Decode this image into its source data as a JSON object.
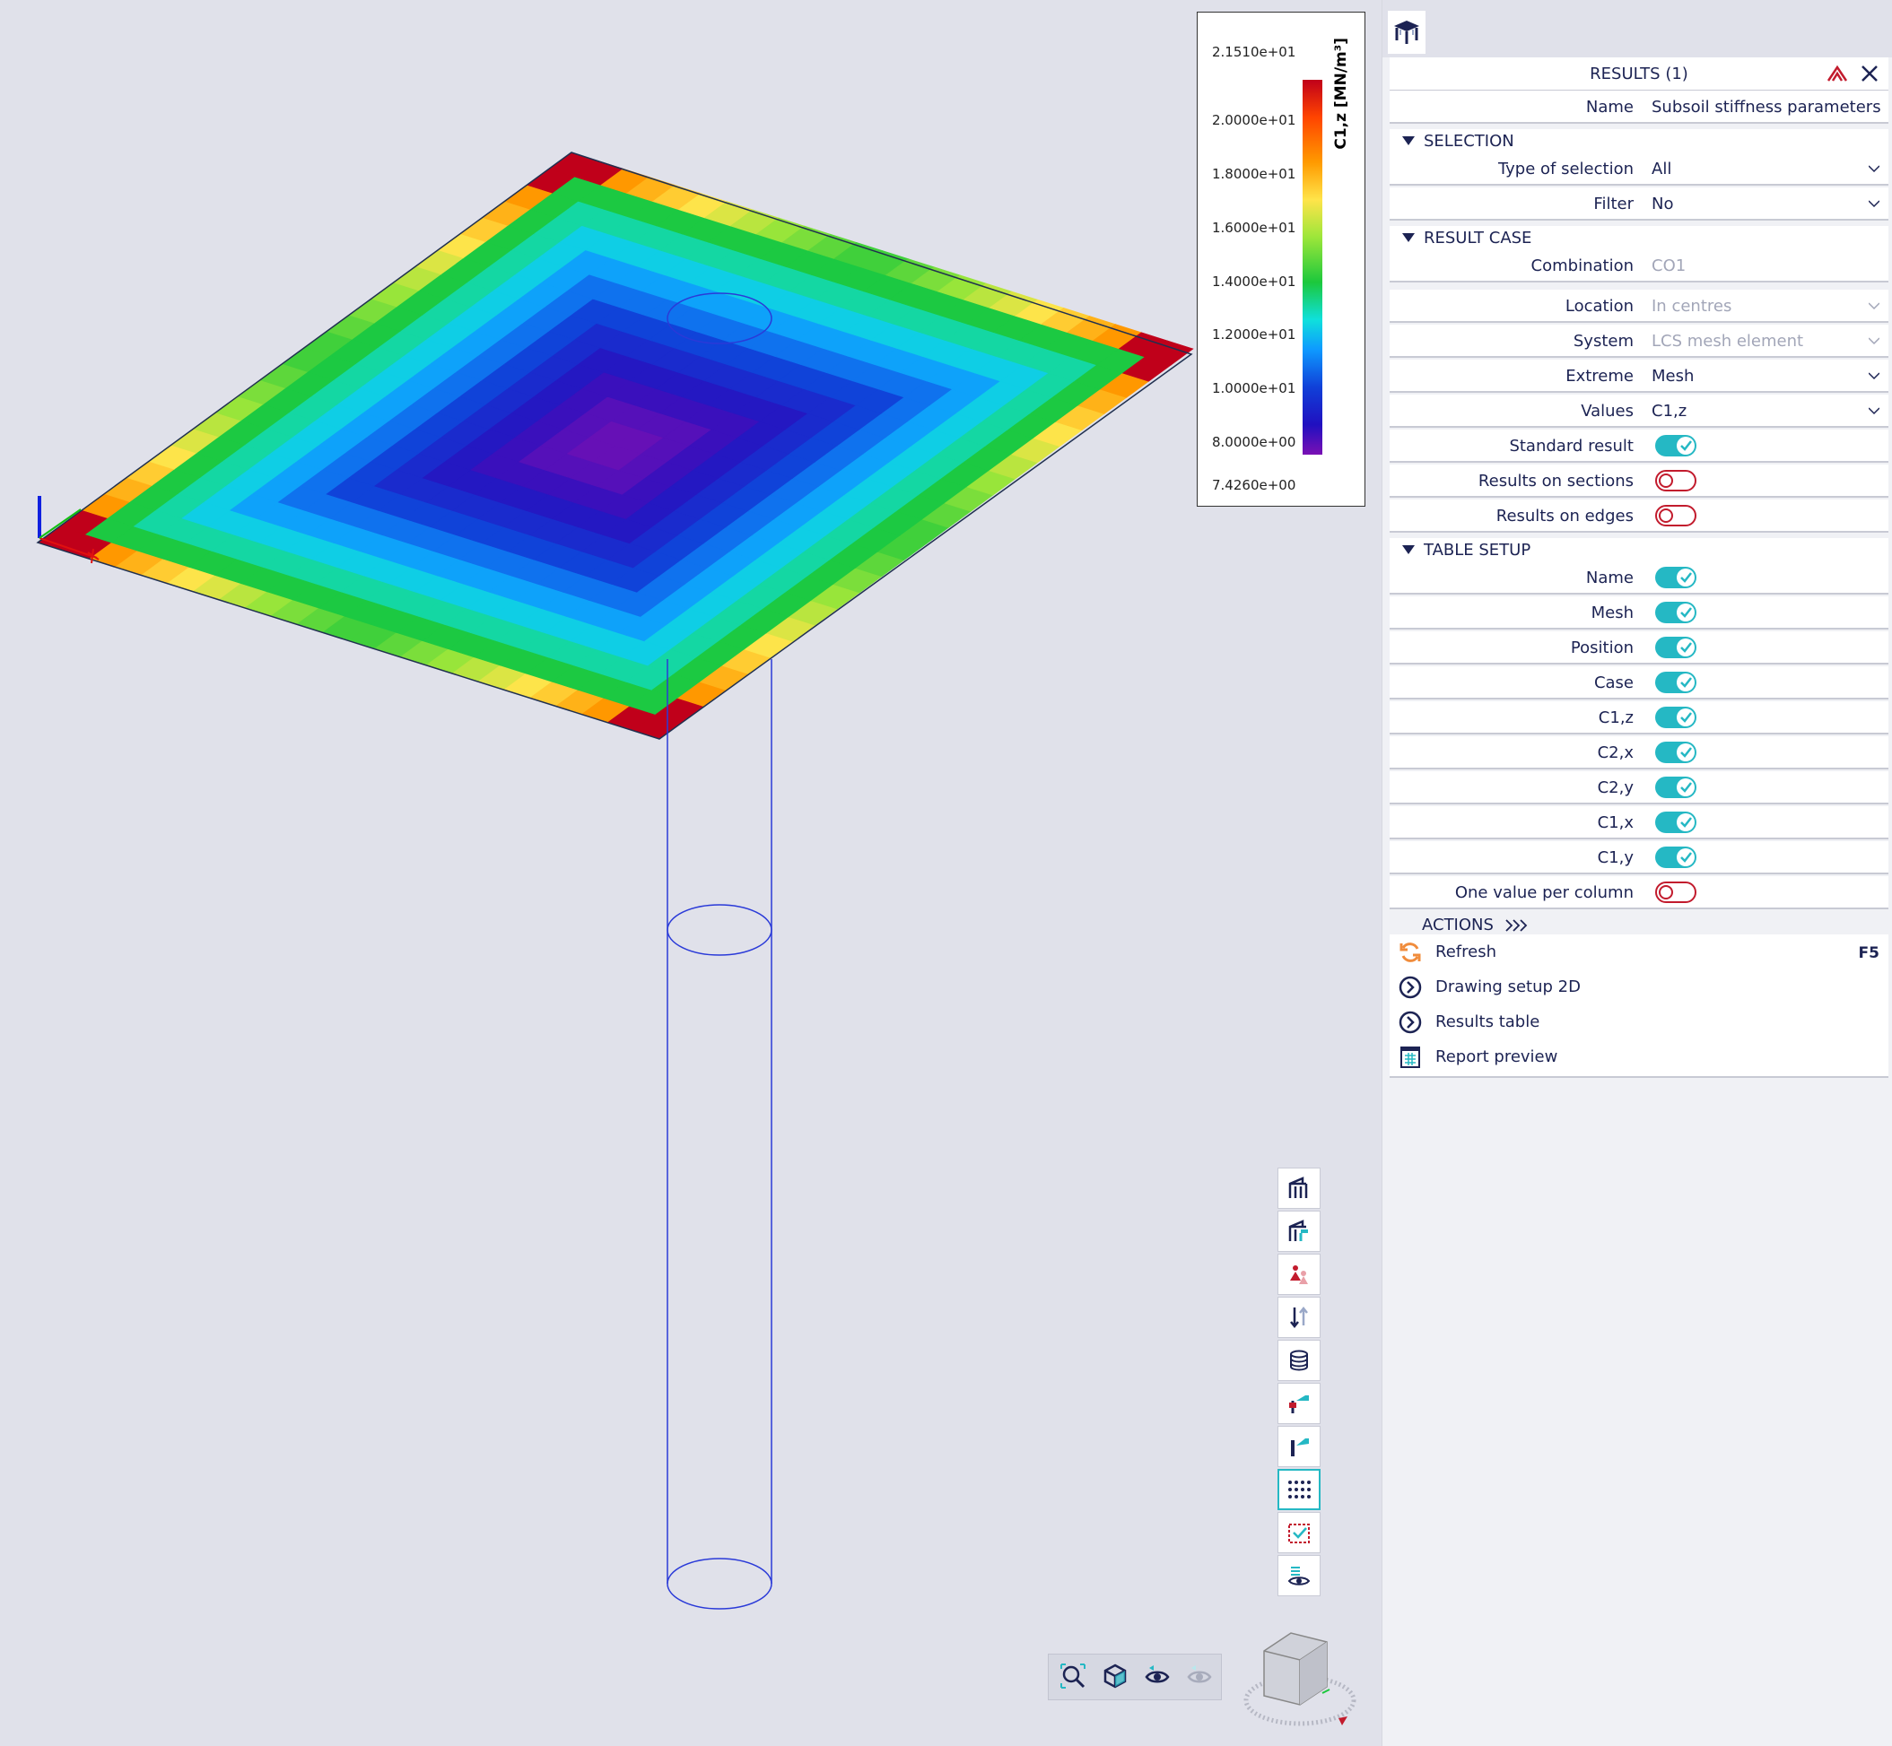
{
  "legend": {
    "unit": "C1,z [MN/m³]",
    "ticks": [
      "2.1510e+01",
      "2.0000e+01",
      "1.8000e+01",
      "1.6000e+01",
      "1.4000e+01",
      "1.2000e+01",
      "1.0000e+01",
      "8.0000e+00",
      "7.4260e+00"
    ]
  },
  "panel": {
    "title": "RESULTS (1)",
    "name_label": "Name",
    "name_value": "Subsoil stiffness parameters",
    "selection": {
      "header": "SELECTION",
      "type_label": "Type of selection",
      "type_value": "All",
      "filter_label": "Filter",
      "filter_value": "No"
    },
    "result_case": {
      "header": "RESULT CASE",
      "combination_label": "Combination",
      "combination_value": "CO1"
    },
    "location_label": "Location",
    "location_value": "In centres",
    "system_label": "System",
    "system_value": "LCS mesh element",
    "extreme_label": "Extreme",
    "extreme_value": "Mesh",
    "values_label": "Values",
    "values_value": "C1,z",
    "standard_label": "Standard result",
    "standard_on": true,
    "sections_label": "Results on sections",
    "sections_on": false,
    "edges_label": "Results on edges",
    "edges_on": false,
    "table_setup": {
      "header": "TABLE SETUP",
      "items": [
        {
          "label": "Name",
          "on": true
        },
        {
          "label": "Mesh",
          "on": true
        },
        {
          "label": "Position",
          "on": true
        },
        {
          "label": "Case",
          "on": true
        },
        {
          "label": "C1,z",
          "on": true
        },
        {
          "label": "C2,x",
          "on": true
        },
        {
          "label": "C2,y",
          "on": true
        },
        {
          "label": "C1,x",
          "on": true
        },
        {
          "label": "C1,y",
          "on": true
        },
        {
          "label": "One value per column",
          "on": false
        }
      ]
    },
    "actions": {
      "header": "ACTIONS",
      "refresh": "Refresh",
      "refresh_key": "F5",
      "drawing_setup": "Drawing setup 2D",
      "results_table": "Results table",
      "report_preview": "Report preview"
    }
  },
  "colors": {
    "accent": "#25b8c4",
    "text": "#1c2353",
    "off": "#c21b2d"
  },
  "icons": {
    "vertical_toolbar": [
      "structure-icon",
      "structure-color-icon",
      "load-icon",
      "support-icon",
      "database-icon",
      "member-icon",
      "member-2d-icon",
      "mesh-dots-icon",
      "select-icon",
      "view-eye-icon"
    ],
    "bottom_toolbar": [
      "zoom-all-icon",
      "view-3d-icon",
      "visibility-icon",
      "visibility-off-icon"
    ]
  }
}
